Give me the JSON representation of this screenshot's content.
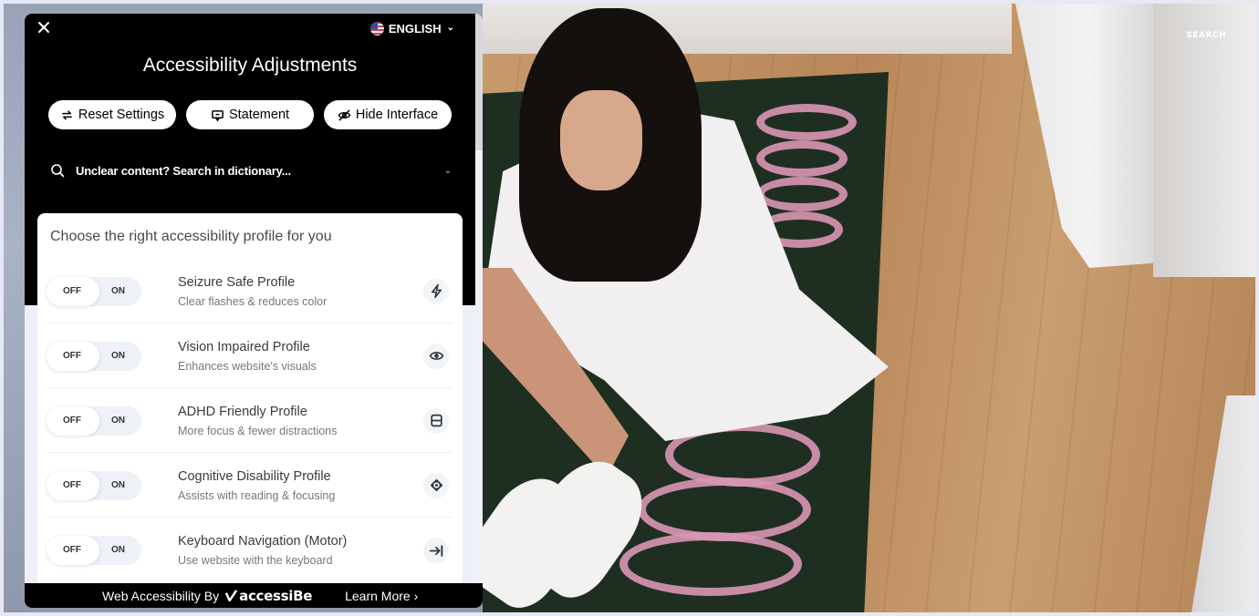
{
  "site": {
    "search_label": "SEARCH"
  },
  "panel": {
    "title": "Accessibility Adjustments",
    "close_icon": "close-icon",
    "language": {
      "label": "ENGLISH",
      "flag_icon": "us-flag-icon",
      "chevron": "⌄"
    },
    "actions": [
      {
        "label": "Reset Settings",
        "icon": "reset-icon"
      },
      {
        "label": "Statement",
        "icon": "statement-icon"
      },
      {
        "label": "Hide Interface",
        "icon": "hide-icon"
      }
    ],
    "dictionary": {
      "placeholder": "Unclear content? Search in dictionary...",
      "icon": "search-icon",
      "chevron": "⌄"
    },
    "profiles_heading": "Choose the right accessibility profile for you",
    "toggle_off": "OFF",
    "toggle_on": "ON",
    "profiles": [
      {
        "name": "Seizure Safe Profile",
        "desc": "Clear flashes & reduces color",
        "icon": "lightning-icon",
        "state": "off"
      },
      {
        "name": "Vision Impaired Profile",
        "desc": "Enhances website's visuals",
        "icon": "eye-icon",
        "state": "off"
      },
      {
        "name": "ADHD Friendly Profile",
        "desc": "More focus & fewer distractions",
        "icon": "focus-frame-icon",
        "state": "off"
      },
      {
        "name": "Cognitive Disability Profile",
        "desc": "Assists with reading & focusing",
        "icon": "target-icon",
        "state": "off"
      },
      {
        "name": "Keyboard Navigation (Motor)",
        "desc": "Use website with the keyboard",
        "icon": "tab-arrow-icon",
        "state": "off"
      }
    ],
    "footer": {
      "by_label": "Web Accessibility By",
      "brand": "accessiBe",
      "learn_more": "Learn More ›"
    }
  }
}
